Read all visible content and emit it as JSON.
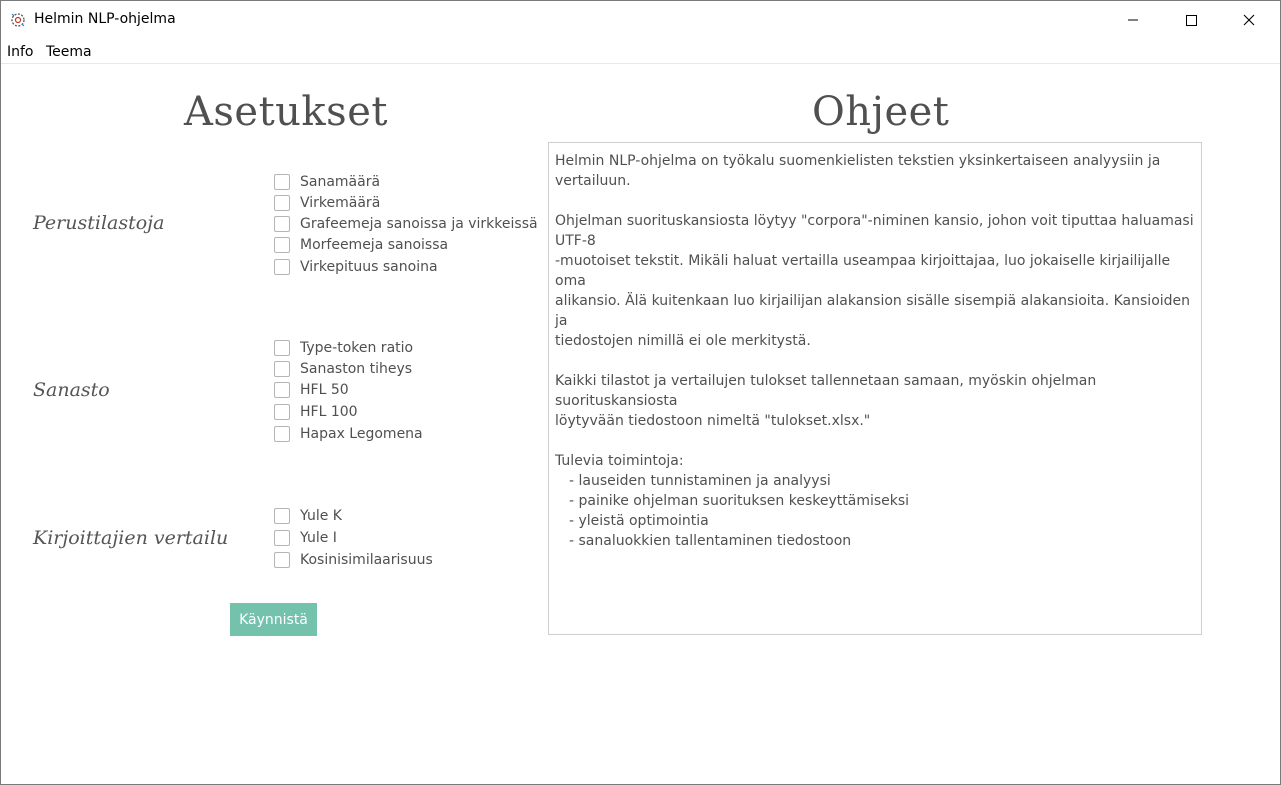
{
  "window": {
    "title": "Helmin NLP-ohjelma",
    "app_icon": "settings-gear-icon",
    "controls": {
      "minimize_icon": "minimize-icon",
      "maximize_icon": "maximize-icon",
      "close_icon": "close-icon"
    }
  },
  "menubar": {
    "items": [
      {
        "label": "Info"
      },
      {
        "label": "Teema"
      }
    ]
  },
  "settings": {
    "heading": "Asetukset",
    "sections": [
      {
        "label": "Perustilastoja",
        "options": [
          {
            "label": "Sanamäärä",
            "checked": false
          },
          {
            "label": "Virkemäärä",
            "checked": false
          },
          {
            "label": "Grafeemeja sanoissa ja virkkeissä",
            "checked": false
          },
          {
            "label": "Morfeemeja sanoissa",
            "checked": false
          },
          {
            "label": "Virkepituus sanoina",
            "checked": false
          }
        ]
      },
      {
        "label": "Sanasto",
        "options": [
          {
            "label": "Type-token ratio",
            "checked": false
          },
          {
            "label": "Sanaston tiheys",
            "checked": false
          },
          {
            "label": "HFL 50",
            "checked": false
          },
          {
            "label": "HFL 100",
            "checked": false
          },
          {
            "label": "Hapax Legomena",
            "checked": false
          }
        ]
      },
      {
        "label": "Kirjoittajien vertailu",
        "options": [
          {
            "label": "Yule K",
            "checked": false
          },
          {
            "label": "Yule I",
            "checked": false
          },
          {
            "label": "Kosinisimilaarisuus",
            "checked": false
          }
        ]
      }
    ],
    "start_button": "Käynnistä"
  },
  "instructions": {
    "heading": "Ohjeet",
    "intro": "Helmin NLP-ohjelma on työkalu suomenkielisten tekstien yksinkertaiseen analyysiin ja vertailuun.",
    "para2_lines": [
      "Ohjelman suorituskansiosta löytyy \"corpora\"-niminen kansio, johon voit tiputtaa haluamasi UTF-8",
      "-muotoiset tekstit. Mikäli haluat vertailla useampaa kirjoittajaa, luo jokaiselle kirjailijalle oma",
      "alikansio. Älä kuitenkaan luo kirjailijan alakansion sisälle sisempiä alakansioita. Kansioiden ja",
      "tiedostojen nimillä ei ole merkitystä."
    ],
    "para3_lines": [
      "Kaikki tilastot ja vertailujen tulokset tallennetaan samaan, myöskin ohjelman suorituskansiosta",
      "löytyvään tiedostoon nimeltä \"tulokset.xlsx.\""
    ],
    "upcoming_title": "Tulevia toimintoja:",
    "upcoming_items": [
      "- lauseiden tunnistaminen ja analyysi",
      "- painike ohjelman suorituksen keskeyttämiseksi",
      "- yleistä optimointia",
      "- sanaluokkien tallentaminen tiedostoon"
    ]
  },
  "colors": {
    "accent_button": "#74c2ab",
    "heading_text": "#505050",
    "body_text": "#505050"
  }
}
